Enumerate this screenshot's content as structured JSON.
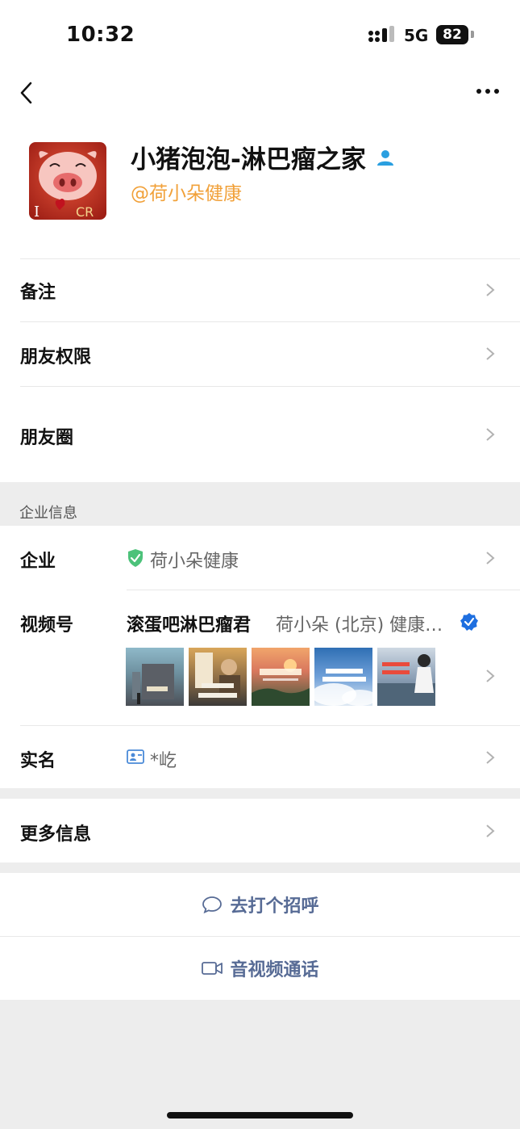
{
  "status_bar": {
    "time": "10:32",
    "network": "5G",
    "battery": "82"
  },
  "profile": {
    "name": "小猪泡泡-淋巴瘤之家",
    "company_at": "@荷小朵健康",
    "avatar_text_i": "I",
    "avatar_text_cr": "CR"
  },
  "rows": {
    "remark": "备注",
    "friend_permissions": "朋友权限",
    "moments": "朋友圈"
  },
  "enterprise": {
    "section_title": "企业信息",
    "company_label": "企业",
    "company_value": "荷小朵健康",
    "channels_label": "视频号",
    "channel_name": "滚蛋吧淋巴瘤君",
    "channel_org": "荷小朵 (北京) 健康…",
    "thumbnails": [
      {
        "caption": ""
      },
      {
        "caption": ""
      },
      {
        "caption": ""
      },
      {
        "caption": ""
      },
      {
        "caption": ""
      }
    ],
    "realname_label": "实名",
    "realname_value": "*屹"
  },
  "more_info": "更多信息",
  "actions": {
    "greet": "去打个招呼",
    "call": "音视频通话"
  },
  "colors": {
    "accent_orange": "#f1a13a",
    "link_blue": "#576b95",
    "shield_green": "#4cc27a",
    "verified_blue": "#1e6fe0"
  }
}
